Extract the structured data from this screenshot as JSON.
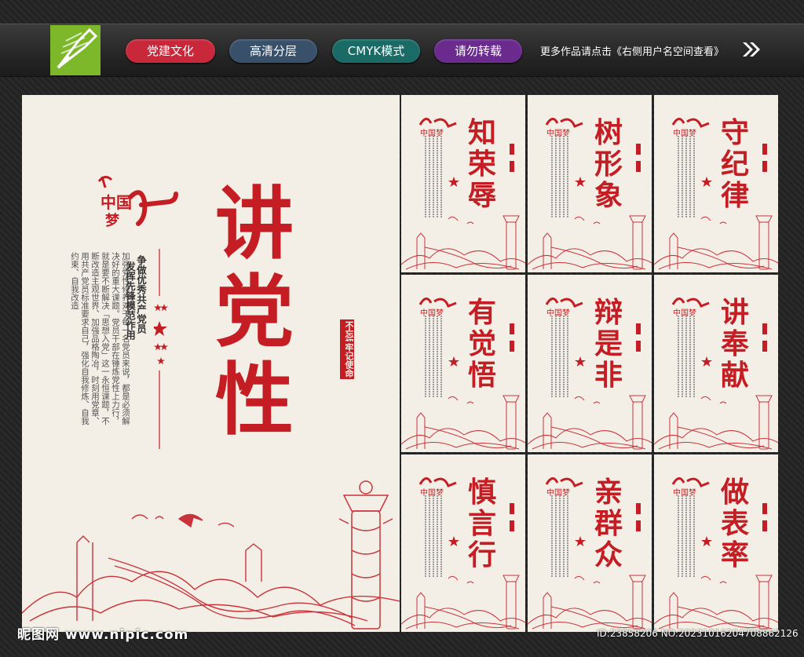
{
  "toolbar": {
    "tags": [
      "党建文化",
      "高清分层",
      "CMYK模式",
      "请勿转载"
    ],
    "more_text": "更多作品请点击《右侧用户名空间查看》",
    "colors": {
      "red": "#c8283a",
      "slate": "#39506b",
      "teal": "#1a6b66",
      "purple": "#6a2a8e",
      "logo_green": "#7db82a"
    }
  },
  "main_poster": {
    "title": [
      "讲",
      "党",
      "性"
    ],
    "slogan": [
      "争做优秀共产党员",
      "发挥先锋模范作用"
    ],
    "seal": [
      "不忘初心",
      "牢记使命"
    ],
    "body": "加强党性修养对于每一名党员来说，都是必须解决好的重大课题。党员干部在锤炼党性上力行，就是要不断解决「思想入党」这一永恒课题，不断改造主观世界、加强品格陶冶，时刻用党章、用共产党员标准要求自己，强化自我修炼、自我约束、自我改造",
    "logo": "中国梦",
    "accent": "#c41d24"
  },
  "cards": [
    {
      "title": [
        "知",
        "荣",
        "辱"
      ]
    },
    {
      "title": [
        "树",
        "形",
        "象"
      ]
    },
    {
      "title": [
        "守",
        "纪",
        "律"
      ]
    },
    {
      "title": [
        "有",
        "觉",
        "悟"
      ]
    },
    {
      "title": [
        "辩",
        "是",
        "非"
      ]
    },
    {
      "title": [
        "讲",
        "奉",
        "献"
      ]
    },
    {
      "title": [
        "慎",
        "言",
        "行"
      ]
    },
    {
      "title": [
        "亲",
        "群",
        "众"
      ]
    },
    {
      "title": [
        "做",
        "表",
        "率"
      ]
    }
  ],
  "watermark": {
    "left": "昵图网 www.nipic.com",
    "right": "ID:23858206 NO:20231016204708862126"
  }
}
